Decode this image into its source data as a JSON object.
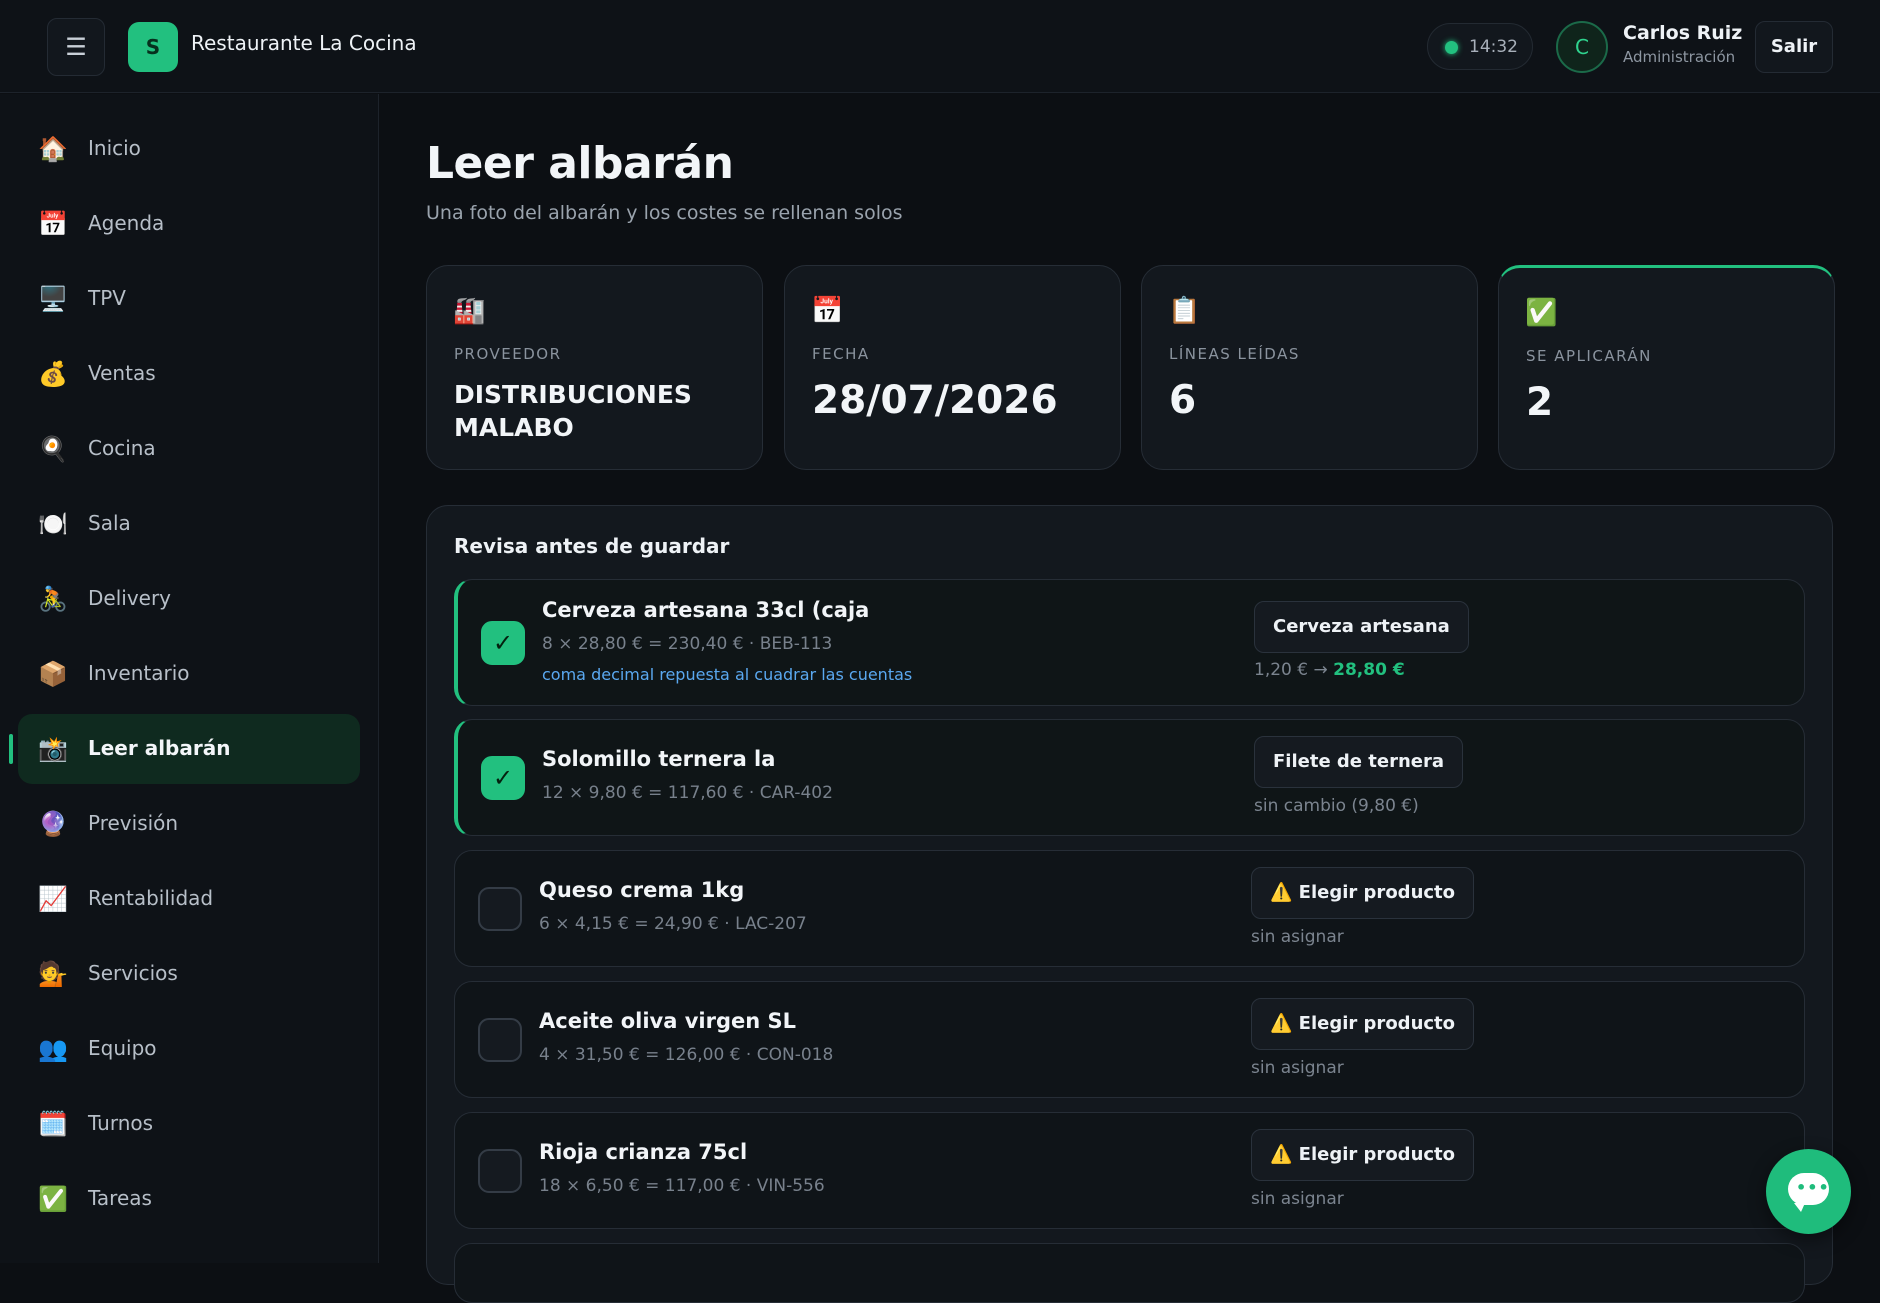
{
  "header": {
    "menu_icon": "hamburger-icon",
    "menu_glyph": "☰",
    "brand_initial": "S",
    "brand_name": "Restaurante La Cocina",
    "clock": "14:32",
    "user_initial": "C",
    "user_name": "Carlos Ruiz",
    "user_role": "Administración",
    "logout_label": "Salir"
  },
  "sidebar": {
    "items": [
      {
        "label": "Inicio",
        "icon": "🏠",
        "icon_name": "house-icon"
      },
      {
        "label": "Agenda",
        "icon": "📅",
        "icon_name": "calendar-icon"
      },
      {
        "label": "TPV",
        "icon": "🖥️",
        "icon_name": "desktop-computer-icon"
      },
      {
        "label": "Ventas",
        "icon": "💰",
        "icon_name": "money-bag-icon"
      },
      {
        "label": "Cocina",
        "icon": "🍳",
        "icon_name": "frying-pan-icon"
      },
      {
        "label": "Sala",
        "icon": "🍽️",
        "icon_name": "plate-cutlery-icon"
      },
      {
        "label": "Delivery",
        "icon": "🚴",
        "icon_name": "cyclist-icon"
      },
      {
        "label": "Inventario",
        "icon": "📦",
        "icon_name": "package-icon"
      },
      {
        "label": "Leer albarán",
        "icon": "📸",
        "icon_name": "camera-icon",
        "active": true
      },
      {
        "label": "Previsión",
        "icon": "🔮",
        "icon_name": "crystal-ball-icon"
      },
      {
        "label": "Rentabilidad",
        "icon": "📈",
        "icon_name": "chart-up-icon"
      },
      {
        "label": "Servicios",
        "icon": "💁",
        "icon_name": "person-tipping-hand-icon"
      },
      {
        "label": "Equipo",
        "icon": "👥",
        "icon_name": "people-icon"
      },
      {
        "label": "Turnos",
        "icon": "🗓️",
        "icon_name": "spiral-calendar-icon"
      },
      {
        "label": "Tareas",
        "icon": "✅",
        "icon_name": "check-mark-icon"
      }
    ]
  },
  "main": {
    "title": "Leer albarán",
    "subtitle": "Una foto del albarán y los costes se rellenan solos",
    "stats": [
      {
        "icon": "🏭",
        "icon_name": "factory-icon",
        "label": "PROVEEDOR",
        "value": "DISTRIBUCIONES MALABO"
      },
      {
        "icon": "📅",
        "icon_name": "calendar-icon",
        "label": "FECHA",
        "value": "28/07/2026"
      },
      {
        "icon": "📋",
        "icon_name": "clipboard-icon",
        "label": "LÍNEAS LEÍDAS",
        "value": "6"
      },
      {
        "icon": "✅",
        "icon_name": "check-mark-icon",
        "label": "SE APLICARÁN",
        "value": "2"
      }
    ],
    "review_title": "Revisa antes de guardar",
    "lines": [
      {
        "checked": true,
        "check_glyph": "✓",
        "name": "Cerveza artesana 33cl (caja",
        "detail": "8 × 28,80 € = 230,40 € · BEB-113",
        "note": "coma decimal repuesta al cuadrar las cuentas",
        "product": "Cerveza artesana",
        "price_old": "1,20 €",
        "price_arrow": "→",
        "price_new": "28,80 €"
      },
      {
        "checked": true,
        "check_glyph": "✓",
        "name": "Solomillo ternera la",
        "detail": "12 × 9,80 € = 117,60 € · CAR-402",
        "product": "Filete de ternera",
        "status": "sin cambio (9,80 €)"
      },
      {
        "checked": false,
        "name": "Queso crema 1kg",
        "detail": "6 × 4,15 € = 24,90 € · LAC-207",
        "product": "⚠️ Elegir producto",
        "status": "sin asignar"
      },
      {
        "checked": false,
        "name": "Aceite oliva virgen SL",
        "detail": "4 × 31,50 € = 126,00 € · CON-018",
        "product": "⚠️ Elegir producto",
        "status": "sin asignar"
      },
      {
        "checked": false,
        "name": "Rioja crianza 75cl",
        "detail": "18 × 6,50 € = 117,00 € · VIN-556",
        "product": "⚠️ Elegir producto",
        "status": "sin asignar"
      }
    ]
  },
  "chat": {
    "icon_name": "chat-bubble-icon",
    "dots": "•••"
  },
  "colors": {
    "accent": "#22c07f",
    "background": "#0c0f13",
    "card": "#13181e",
    "note_link": "#5aa8f0"
  }
}
